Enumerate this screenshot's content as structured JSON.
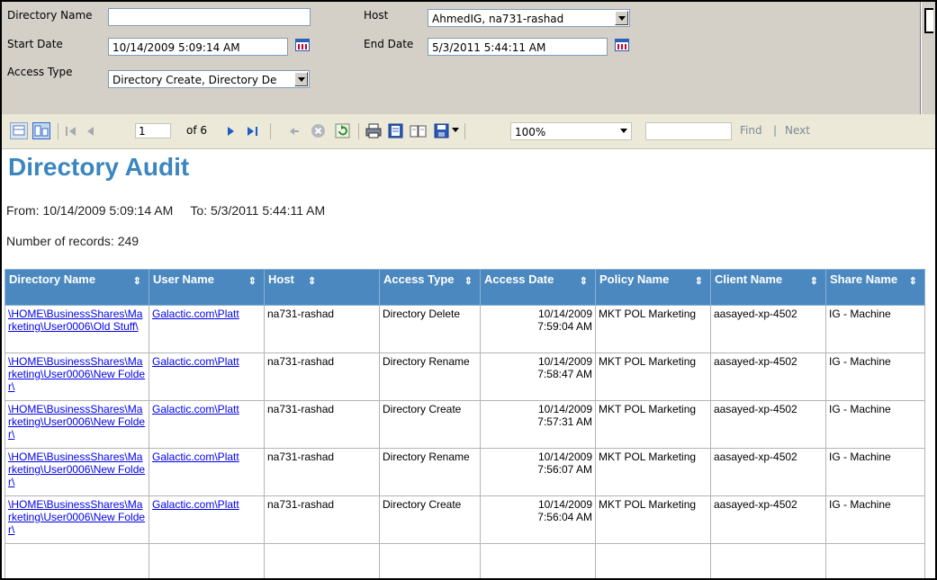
{
  "params": {
    "directory_name_label": "Directory Name",
    "directory_name_value": "",
    "host_label": "Host",
    "host_value": "AhmedIG, na731-rashad",
    "start_date_label": "Start Date",
    "start_date_value": "10/14/2009 5:09:14 AM",
    "end_date_label": "End Date",
    "end_date_value": "5/3/2011 5:44:11 AM",
    "access_type_label": "Access Type",
    "access_type_value": "Directory Create, Directory De"
  },
  "toolbar": {
    "current_page": "1",
    "of_pages": "of 6",
    "zoom": "100%",
    "find_label": "Find",
    "find_separator": "|",
    "next_label": "Next"
  },
  "report": {
    "title": "Directory Audit",
    "range_text": "From: 10/14/2009 5:09:14 AM     To: 5/3/2011 5:44:11 AM",
    "records_text": "Number of records: 249",
    "columns": [
      {
        "label": "Directory Name"
      },
      {
        "label": "User Name"
      },
      {
        "label": "Host"
      },
      {
        "label": "Access Type"
      },
      {
        "label": "Access Date"
      },
      {
        "label": "Policy Name"
      },
      {
        "label": "Client Name"
      },
      {
        "label": "Share Name"
      }
    ],
    "rows": [
      {
        "directory": "\\HOME\\BusinessShares\\Marketing\\User0006\\Old Stuff\\",
        "user": "Galactic.com\\Platt",
        "host": "na731-rashad",
        "access_type": "Directory Delete",
        "date": "10/14/2009",
        "time": "7:59:04 AM",
        "policy": "MKT POL Marketing",
        "client": "aasayed-xp-4502",
        "share": "IG - Machine"
      },
      {
        "directory": "\\HOME\\BusinessShares\\Marketing\\User0006\\New Folder\\",
        "user": "Galactic.com\\Platt",
        "host": "na731-rashad",
        "access_type": "Directory Rename",
        "date": "10/14/2009",
        "time": "7:58:47 AM",
        "policy": "MKT POL Marketing",
        "client": "aasayed-xp-4502",
        "share": "IG - Machine"
      },
      {
        "directory": "\\HOME\\BusinessShares\\Marketing\\User0006\\New Folder\\",
        "user": "Galactic.com\\Platt",
        "host": "na731-rashad",
        "access_type": "Directory Create",
        "date": "10/14/2009",
        "time": "7:57:31 AM",
        "policy": "MKT POL Marketing",
        "client": "aasayed-xp-4502",
        "share": "IG - Machine"
      },
      {
        "directory": "\\HOME\\BusinessShares\\Marketing\\User0006\\New Folder\\",
        "user": "Galactic.com\\Platt",
        "host": "na731-rashad",
        "access_type": "Directory Rename",
        "date": "10/14/2009",
        "time": "7:56:07 AM",
        "policy": "MKT POL Marketing",
        "client": "aasayed-xp-4502",
        "share": "IG - Machine"
      },
      {
        "directory": "\\HOME\\BusinessShares\\Marketing\\User0006\\New Folder\\",
        "user": "Galactic.com\\Platt",
        "host": "na731-rashad",
        "access_type": "Directory Create",
        "date": "10/14/2009",
        "time": "7:56:04 AM",
        "policy": "MKT POL Marketing",
        "client": "aasayed-xp-4502",
        "share": "IG - Machine"
      }
    ]
  },
  "colors": {
    "title": "#3c86bf",
    "header_bg": "#4a88bf",
    "params_bg": "#d4d0c8",
    "toolbar_bg": "#ece9d8",
    "link": "#0000ee"
  }
}
